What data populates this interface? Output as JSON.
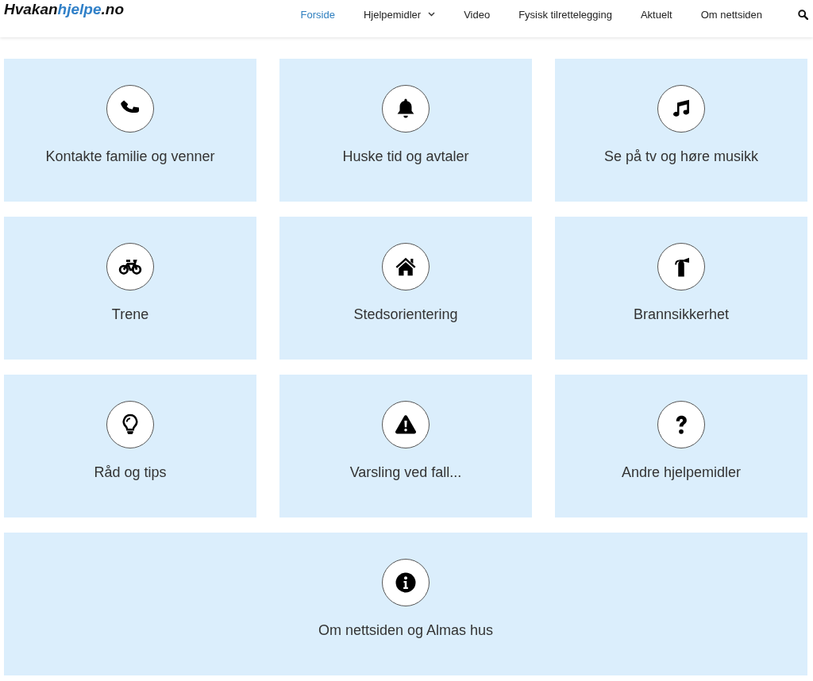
{
  "logo": {
    "parts": [
      {
        "text": "Hvakan",
        "highlight": false
      },
      {
        "text": "hjelpe",
        "highlight": true
      },
      {
        "text": ".no",
        "highlight": false
      }
    ]
  },
  "nav": [
    {
      "label": "Forside",
      "selected": true,
      "has_menu": false
    },
    {
      "label": "Hjelpemidler",
      "selected": false,
      "has_menu": true
    },
    {
      "label": "Video",
      "selected": false,
      "has_menu": false
    },
    {
      "label": "Fysisk tilrettelegging",
      "selected": false,
      "has_menu": false
    },
    {
      "label": "Aktuelt",
      "selected": false,
      "has_menu": false
    },
    {
      "label": "Om nettsiden",
      "selected": false,
      "has_menu": false
    }
  ],
  "tiles": [
    {
      "label": "Kontakte familie og venner",
      "kind": "phone",
      "wide": false
    },
    {
      "label": "Huske tid og avtaler",
      "kind": "bell",
      "wide": false
    },
    {
      "label": "Se på tv og høre musikk",
      "kind": "music",
      "wide": false
    },
    {
      "label": "Trene",
      "kind": "bicycle",
      "wide": false
    },
    {
      "label": "Stedsorientering",
      "kind": "house",
      "wide": false
    },
    {
      "label": "Brannsikkerhet",
      "kind": "extinguisher",
      "wide": false
    },
    {
      "label": "Råd og tips",
      "kind": "bulb",
      "wide": false
    },
    {
      "label": "Varsling ved fall...",
      "kind": "warning",
      "wide": false
    },
    {
      "label": "Andre hjelpemidler",
      "kind": "question",
      "wide": false
    },
    {
      "label": "Om nettsiden og Almas hus",
      "kind": "info",
      "wide": true
    }
  ]
}
